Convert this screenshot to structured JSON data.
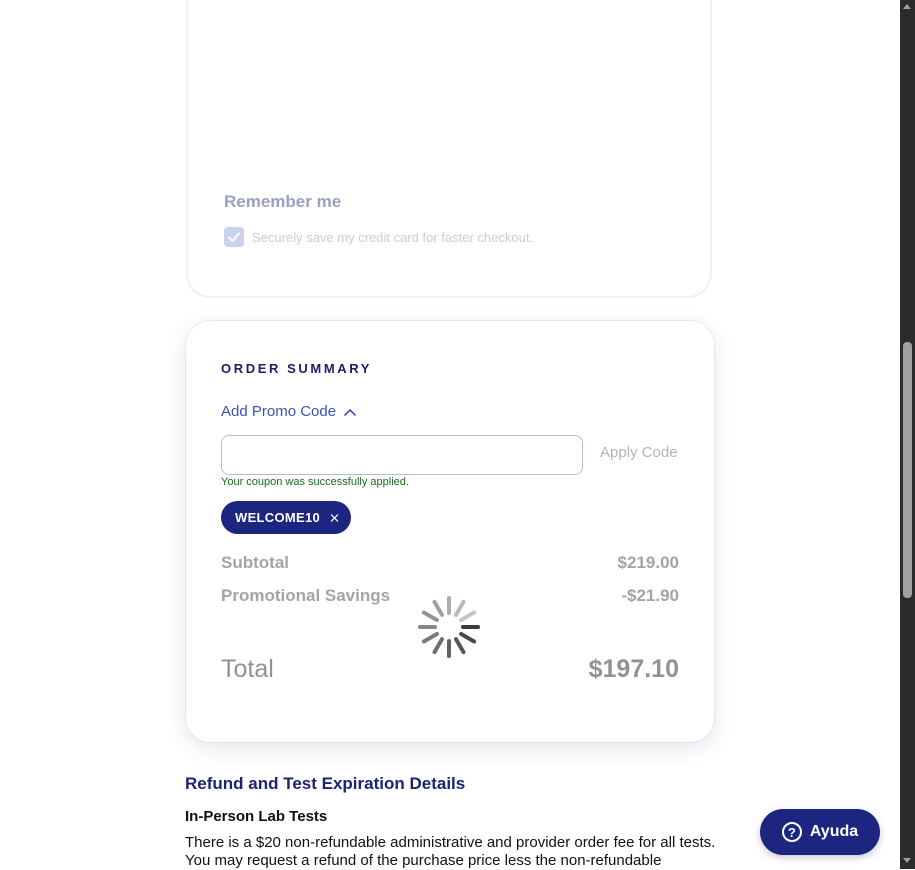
{
  "payment": {
    "remember_title": "Remember me",
    "remember_text": "Securely save my credit card for faster checkout.",
    "remember_checked": true
  },
  "summary": {
    "title": "ORDER SUMMARY",
    "promo_toggle_label": "Add Promo Code",
    "promo_input_value": "",
    "apply_label": "Apply Code",
    "coupon_message": "Your coupon was successfully applied.",
    "coupon_code": "WELCOME10",
    "subtotal_label": "Subtotal",
    "subtotal_value": "$219.00",
    "savings_label": "Promotional Savings",
    "savings_value": "-$21.90",
    "total_label": "Total",
    "total_value": "$197.10",
    "loading": true
  },
  "refund": {
    "title": "Refund and Test Expiration Details",
    "subtitle": "In-Person Lab Tests",
    "text": "There is a $20 non-refundable administrative and provider order fee for all tests. You may request a refund of the purchase price less the non-refundable"
  },
  "help": {
    "label": "Ayuda"
  },
  "colors": {
    "primary": "#1c2580",
    "link": "#3953b8",
    "success": "#1b6b1b"
  }
}
